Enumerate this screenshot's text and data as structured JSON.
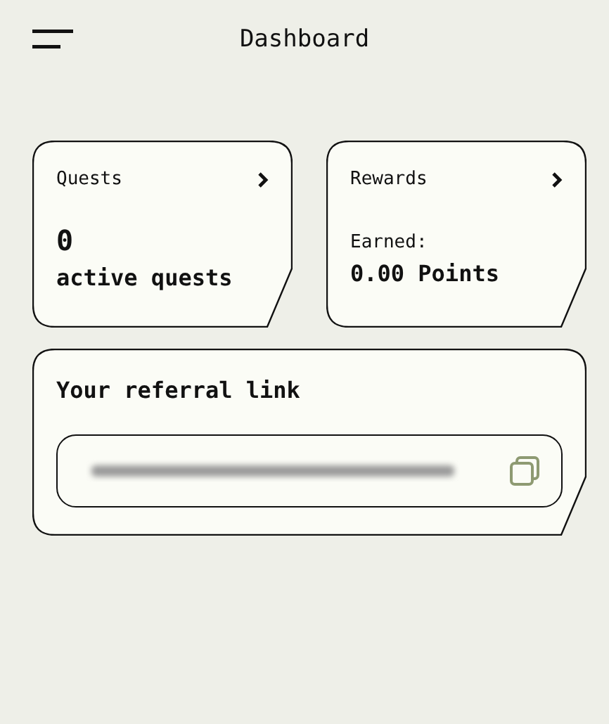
{
  "header": {
    "title": "Dashboard"
  },
  "quests_card": {
    "title": "Quests",
    "count": "0",
    "caption": "active quests"
  },
  "rewards_card": {
    "title": "Rewards",
    "label": "Earned:",
    "value": "0.00 Points"
  },
  "referral": {
    "title": "Your referral link"
  }
}
